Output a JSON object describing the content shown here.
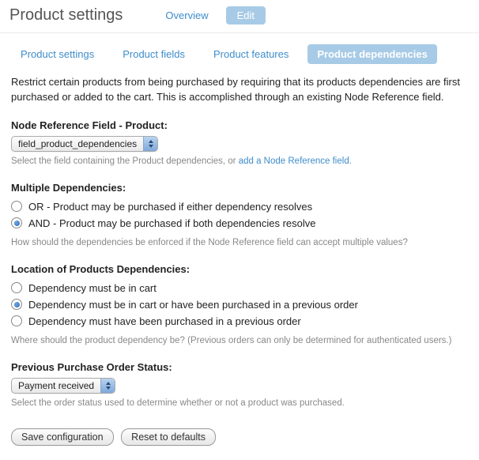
{
  "header": {
    "title": "Product settings",
    "tabs": [
      {
        "label": "Overview"
      },
      {
        "label": "Edit",
        "active": true
      }
    ]
  },
  "nav": [
    {
      "label": "Product settings"
    },
    {
      "label": "Product fields"
    },
    {
      "label": "Product features"
    },
    {
      "label": "Product dependencies",
      "active": true
    }
  ],
  "intro": "Restrict certain products from being purchased by requiring that its products dependencies are first purchased or added to the cart. This is accomplished through an existing Node Reference field.",
  "nodeRef": {
    "label": "Node Reference Field - Product:",
    "selected": "field_product_dependencies",
    "help_pre": "Select the field containing the Product dependencies, or ",
    "help_link": "add a Node Reference field",
    "help_post": "."
  },
  "multi": {
    "label": "Multiple Dependencies:",
    "options": [
      {
        "text": "OR - Product may be purchased if either dependency resolves",
        "checked": false
      },
      {
        "text": "AND - Product may be purchased if both dependencies resolve",
        "checked": true
      }
    ],
    "help": "How should the dependencies be enforced if the Node Reference field can accept multiple values?"
  },
  "location": {
    "label": "Location of Products Dependencies:",
    "options": [
      {
        "text": "Dependency must be in cart",
        "checked": false
      },
      {
        "text": "Dependency must be in cart or have been purchased in a previous order",
        "checked": true
      },
      {
        "text": "Dependency must have been purchased in a previous order",
        "checked": false
      }
    ],
    "help": "Where should the product dependency be? (Previous orders can only be determined for authenticated users.)"
  },
  "prev": {
    "label": "Previous Purchase Order Status:",
    "selected": "Payment received",
    "help": "Select the order status used to determine whether or not a product was purchased."
  },
  "buttons": {
    "save": "Save configuration",
    "reset": "Reset to defaults"
  }
}
